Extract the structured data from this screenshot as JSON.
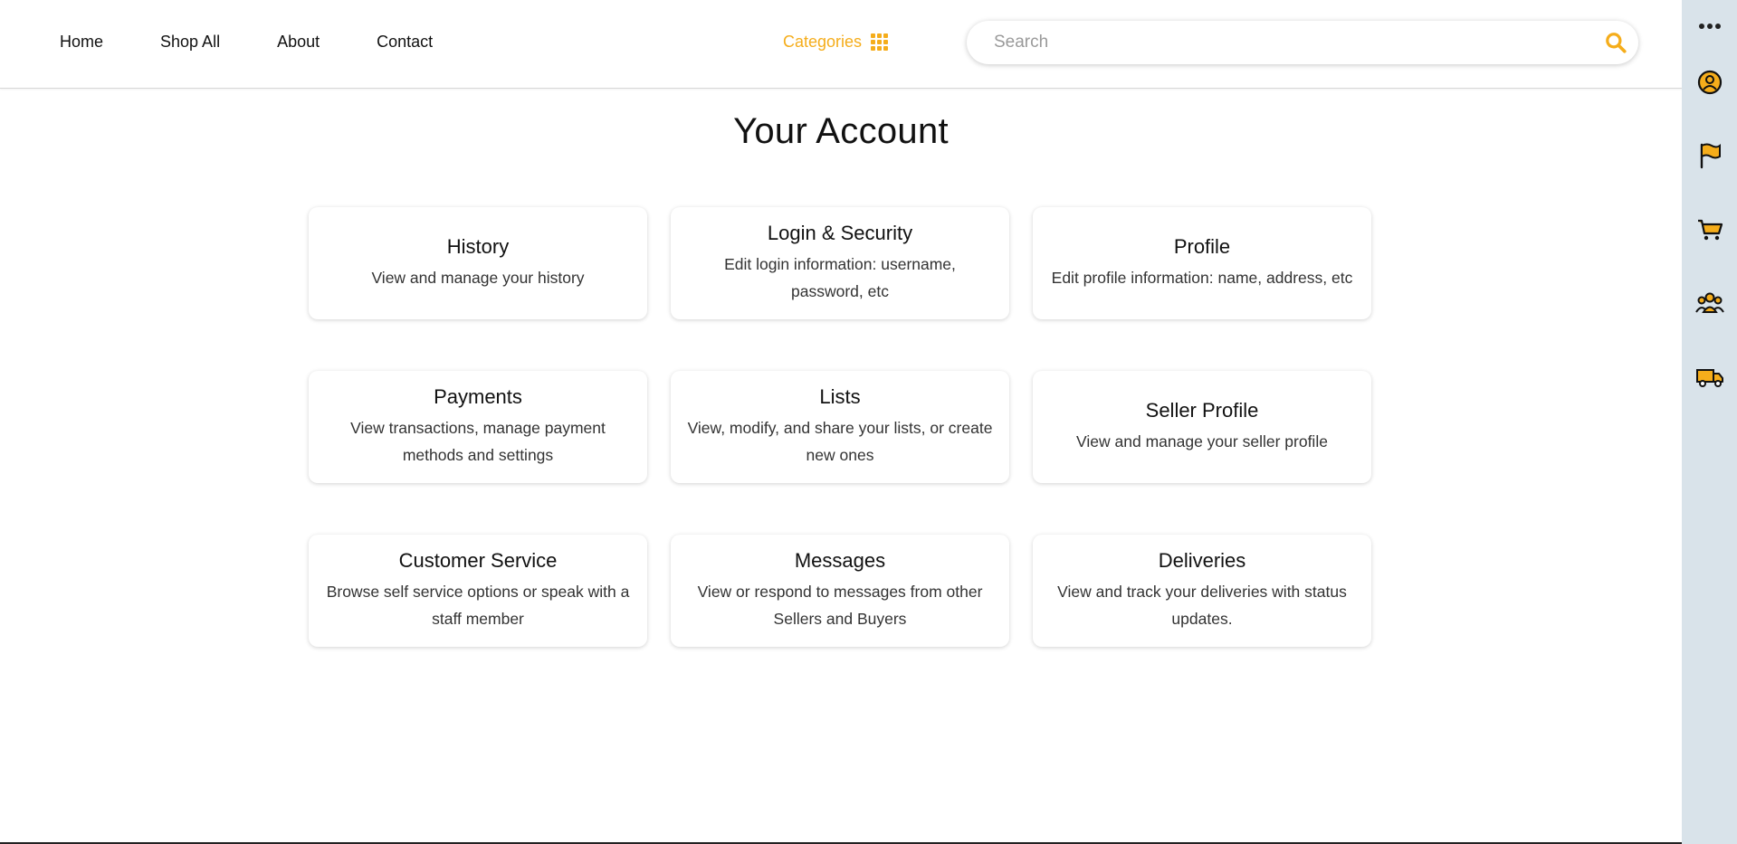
{
  "nav": {
    "links": [
      "Home",
      "Shop All",
      "About",
      "Contact"
    ],
    "categories_label": "Categories"
  },
  "search": {
    "placeholder": "Search",
    "value": ""
  },
  "page_title": "Your Account",
  "cards": [
    {
      "title": "History",
      "description": "View and manage your history"
    },
    {
      "title": "Login & Security",
      "description": "Edit login information: username, password, etc"
    },
    {
      "title": "Profile",
      "description": "Edit profile information: name, address, etc"
    },
    {
      "title": "Payments",
      "description": "View transactions, manage payment methods and settings"
    },
    {
      "title": "Lists",
      "description": "View, modify, and share your lists, or create new ones"
    },
    {
      "title": "Seller Profile",
      "description": "View and manage your seller profile"
    },
    {
      "title": "Customer Service",
      "description": "Browse self service options or speak with a staff member"
    },
    {
      "title": "Messages",
      "description": "View or respond to messages from other Sellers and Buyers"
    },
    {
      "title": "Deliveries",
      "description": "View and track your deliveries with status updates."
    }
  ],
  "sidebar_icons": [
    "more-icon",
    "user-circle-icon",
    "flag-icon",
    "cart-icon",
    "users-icon",
    "truck-icon"
  ],
  "colors": {
    "accent": "#f5ad1b",
    "sidebar_bg": "#d9e3ea"
  }
}
